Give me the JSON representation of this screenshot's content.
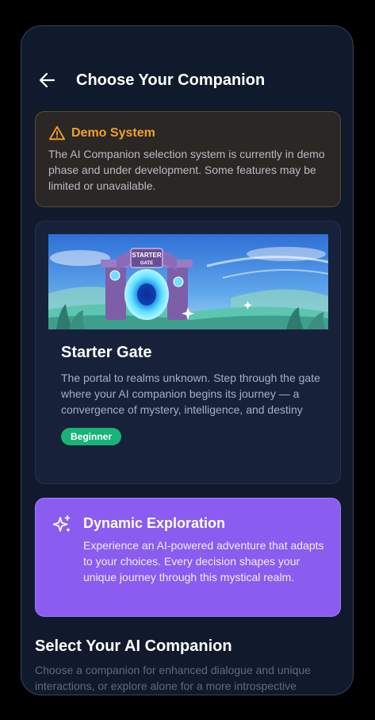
{
  "header": {
    "title": "Choose Your Companion",
    "back_icon": "arrow-left-icon"
  },
  "demo_notice": {
    "icon": "warning-triangle-icon",
    "title": "Demo System",
    "text": "The AI Companion selection system is currently in demo phase and under development. Some features may be limited or unavailable.",
    "accent_color": "#f2a12a"
  },
  "realm_card": {
    "image_sign_line1": "STARTER",
    "image_sign_line2": "GATE",
    "title": "Starter Gate",
    "description": "The portal to realms unknown. Step through the gate where your AI companion begins its journey — a convergence of mystery, intelligence, and destiny",
    "badge": "Beginner",
    "badge_color": "#17b378"
  },
  "exploration": {
    "icon": "sparkles-icon",
    "title": "Dynamic Exploration",
    "description": "Experience an AI-powered adventure that adapts to your choices. Every decision shapes your unique journey through this mystical realm.",
    "background_color": "#8a5cf0"
  },
  "companion_section": {
    "title": "Select Your AI Companion",
    "description": "Choose a companion for enhanced dialogue and unique interactions, or explore alone for a more introspective"
  }
}
